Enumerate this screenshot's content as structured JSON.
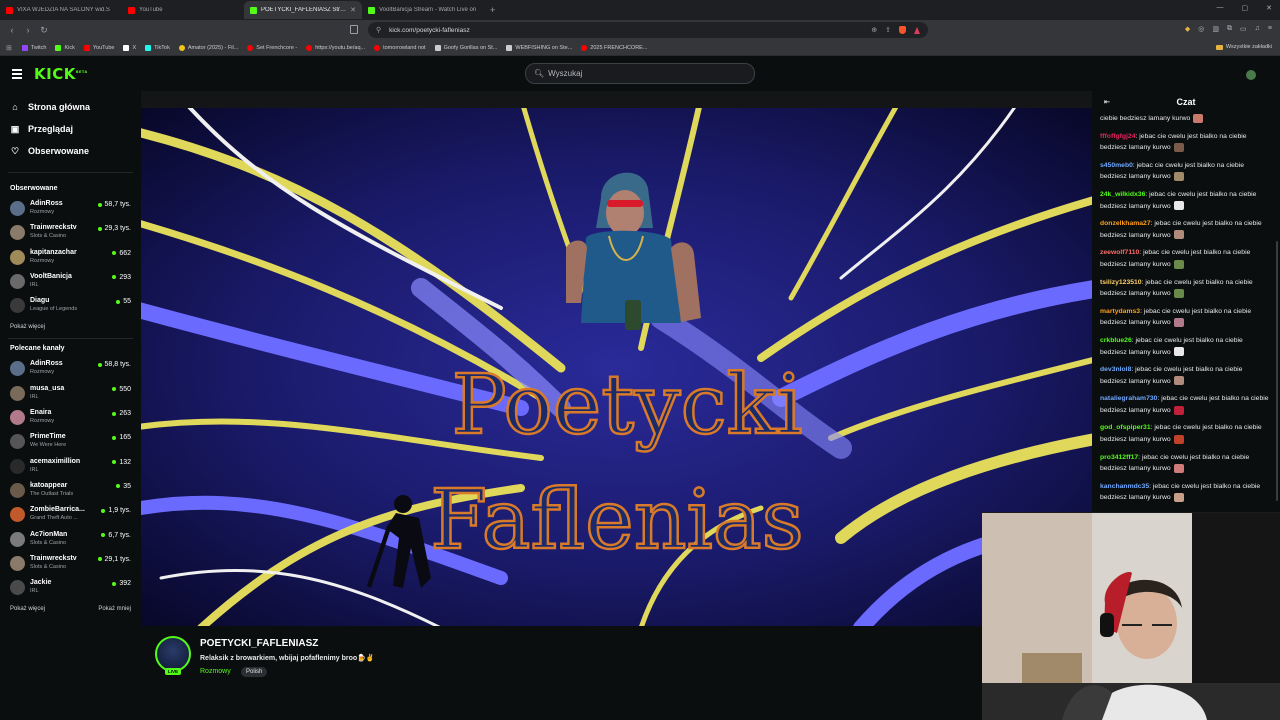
{
  "browser": {
    "tabs": [
      {
        "title": "VIXA WJEDZIA NA SALONY wid.S",
        "color": "#ff0000",
        "active": false
      },
      {
        "title": "YouTube",
        "color": "#ff0000",
        "active": false
      },
      {
        "title": "POETYCKI_FAFLENIASZ Strea",
        "color": "#53fc18",
        "active": true
      },
      {
        "title": "VooltBanicja Stream - Watch Live on",
        "color": "#53fc18",
        "active": false
      }
    ],
    "url": "kick.com/poetycki-fafleniasz",
    "bookmarks": [
      {
        "label": "Twitch",
        "color": "#9146ff"
      },
      {
        "label": "Kick",
        "color": "#53fc18"
      },
      {
        "label": "YouTube",
        "color": "#ff0000"
      },
      {
        "label": "X",
        "color": "#ffffff"
      },
      {
        "label": "TikTok",
        "color": "#25f4ee"
      },
      {
        "label": "Amator (2025) - Fil...",
        "color": "#f0c419"
      },
      {
        "label": "Set Frenchcore -",
        "color": "#ff0000"
      },
      {
        "label": "https://youtu.be/aq...",
        "color": "#ff0000"
      },
      {
        "label": "tomorrowland not",
        "color": "#ff0000"
      },
      {
        "label": "Goofy Gorillas on St...",
        "color": "#cccccc"
      },
      {
        "label": "WEBFISHING on Ste...",
        "color": "#cccccc"
      },
      {
        "label": "2025 FRENCHCORE...",
        "color": "#ff0000"
      }
    ],
    "all_bookmarks": "Wszystkie zakładki"
  },
  "header": {
    "logo": "KICK",
    "logo_tm": "BETA",
    "search_placeholder": "Wyszukaj"
  },
  "sidebar": {
    "nav": [
      {
        "label": "Strona główna",
        "icon": "home-icon",
        "glyph": "⌂"
      },
      {
        "label": "Przeglądaj",
        "icon": "browse-icon",
        "glyph": "▣"
      },
      {
        "label": "Obserwowane",
        "icon": "heart-icon",
        "glyph": "♡"
      }
    ],
    "followed_title": "Obserwowane",
    "followed": [
      {
        "name": "AdinRoss",
        "category": "Rozmowy",
        "viewers": "58,7 tys.",
        "color": "#5a6e8a"
      },
      {
        "name": "Trainwreckstv",
        "category": "Slots & Casino",
        "viewers": "29,3 tys.",
        "color": "#8a7a6a"
      },
      {
        "name": "kapitanzachar",
        "category": "Rozmowy",
        "viewers": "662",
        "color": "#a08a5a"
      },
      {
        "name": "VooltBanicja",
        "category": "IRL",
        "viewers": "293",
        "color": "#6a6a6a"
      },
      {
        "name": "Diagu",
        "category": "League of Legends",
        "viewers": "55",
        "color": "#3a3a3a"
      }
    ],
    "show_more": "Pokaż więcej",
    "recommended_title": "Polecane kanały",
    "recommended": [
      {
        "name": "AdinRoss",
        "category": "Rozmowy",
        "viewers": "58,8 tys.",
        "color": "#5a6e8a"
      },
      {
        "name": "musa_usa",
        "category": "IRL",
        "viewers": "550",
        "color": "#7a6a5a"
      },
      {
        "name": "Enaira",
        "category": "Rozmowy",
        "viewers": "263",
        "color": "#b07a8a"
      },
      {
        "name": "PrimeTime",
        "category": "We Were Here",
        "viewers": "165",
        "color": "#555555"
      },
      {
        "name": "acemaximillion",
        "category": "IRL",
        "viewers": "132",
        "color": "#2a2a2a"
      },
      {
        "name": "katoappear",
        "category": "The Outlast Trials",
        "viewers": "35",
        "color": "#6a5a4a"
      },
      {
        "name": "ZombieBarrica...",
        "category": "Grand Theft Auto ...",
        "viewers": "1,9 tys.",
        "color": "#c05a2a"
      },
      {
        "name": "Ac7ionMan",
        "category": "Slots & Casino",
        "viewers": "6,7 tys.",
        "color": "#7a7a7a"
      },
      {
        "name": "Trainwreckstv",
        "category": "Slots & Casino",
        "viewers": "29,1 tys.",
        "color": "#8a7a6a"
      },
      {
        "name": "Jackie",
        "category": "IRL",
        "viewers": "392",
        "color": "#4a4a4a"
      }
    ],
    "show_more_2": "Pokaż więcej",
    "show_less": "Pokaż mniej"
  },
  "video": {
    "overlay_line1": "Poetycki",
    "overlay_line2": "Faflenias"
  },
  "stream": {
    "channel": "POETYCKI_FAFLENIASZ",
    "title": "Relaksik z browarkiem, wbijaj pofaflenimy broo🍺✌",
    "category": "Rozmowy",
    "tag": "Polish",
    "live_badge": "LIVE"
  },
  "chat": {
    "title": "Czat",
    "messages": [
      {
        "user": "",
        "color": "#ffffff",
        "text": "ciebie bedziesz lamany kurwo",
        "emote": "#c87a6a"
      },
      {
        "user": "fffoffgfgj24",
        "color": "#e0245e",
        "text": "jebac cie cwelu jest bialko na ciebie bedziesz lamany kurwo",
        "emote": "#7a5a4a"
      },
      {
        "user": "s450meb0",
        "color": "#6fa8ff",
        "text": "jebac cie cwelu jest bialko na ciebie bedziesz lamany kurwo",
        "emote": "#a08a6a"
      },
      {
        "user": "24k_wilkidx36",
        "color": "#53fc18",
        "text": "jebac cie cwelu jest bialko na ciebie bedziesz lamany kurwo",
        "emote": "#e8e8e8"
      },
      {
        "user": "donzelkhama27",
        "color": "#ff9f1a",
        "text": "jebac cie cwelu jest bialko na ciebie bedziesz lamany kurwo",
        "emote": "#b08a7a"
      },
      {
        "user": "zeewolf7110",
        "color": "#ff6b6b",
        "text": "jebac cie cwelu jest bialko na ciebie bedziesz lamany kurwo",
        "emote": "#6a8a4a"
      },
      {
        "user": "tsilizy123510",
        "color": "#ffd166",
        "text": "jebac cie cwelu jest bialko na ciebie bedziesz lamany kurwo",
        "emote": "#6a8a4a"
      },
      {
        "user": "martydams3",
        "color": "#ff9f1a",
        "text": "jebac cie cwelu jest bialko na ciebie bedziesz lamany kurwo",
        "emote": "#b07a8a"
      },
      {
        "user": "crkblue26",
        "color": "#53fc18",
        "text": "jebac cie cwelu jest bialko na ciebie bedziesz lamany kurwo",
        "emote": "#e8e8e8"
      },
      {
        "user": "dev3nlol8",
        "color": "#6fa8ff",
        "text": "jebac cie cwelu jest bialko na ciebie bedziesz lamany kurwo",
        "emote": "#b08a7a"
      },
      {
        "user": "nataliegraham730",
        "color": "#6fa8ff",
        "text": "jebac cie cwelu jest bialko na ciebie bedziesz lamany kurwo",
        "emote": "#c0203a"
      },
      {
        "user": "god_ofspiper31",
        "color": "#53fc18",
        "text": "jebac cie cwelu jest bialko na ciebie bedziesz lamany kurwo",
        "emote": "#c0402a"
      },
      {
        "user": "pro3412ff17",
        "color": "#53fc18",
        "text": "jebac cie cwelu jest bialko na ciebie bedziesz lamany kurwo",
        "emote": "#d07a7a"
      },
      {
        "user": "kanchanmdc35",
        "color": "#6fa8ff",
        "text": "jebac cie cwelu jest bialko na ciebie bedziesz lamany kurwo",
        "emote": "#c8a08a"
      }
    ]
  }
}
